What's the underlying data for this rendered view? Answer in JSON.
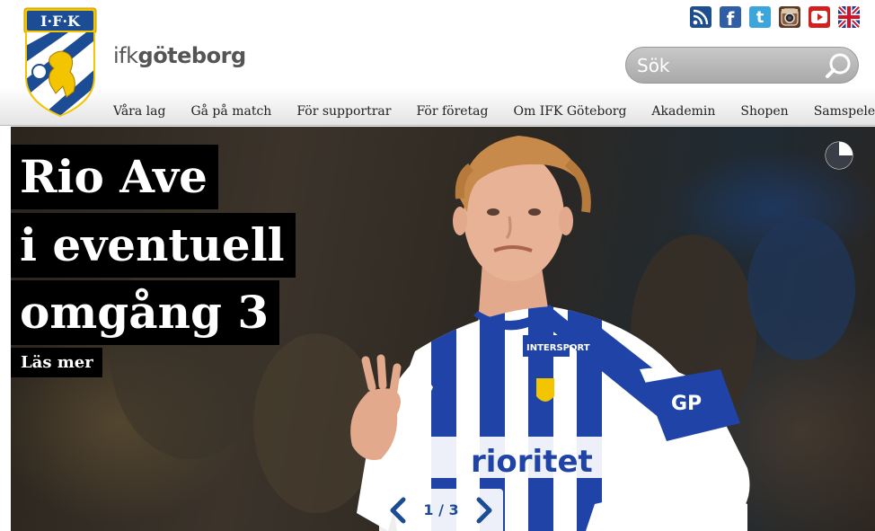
{
  "brand": {
    "logo_letters": "I·F·K",
    "wordmark_light": "ifk",
    "wordmark_bold": "göteborg"
  },
  "social": [
    {
      "name": "rss",
      "label": "RSS"
    },
    {
      "name": "facebook",
      "label": "f"
    },
    {
      "name": "twitter",
      "label": "t"
    },
    {
      "name": "instagram",
      "label": "Instagram"
    },
    {
      "name": "youtube",
      "label": "YouTube"
    },
    {
      "name": "english",
      "label": "English"
    }
  ],
  "search": {
    "placeholder": "Sök",
    "value": ""
  },
  "nav": {
    "items": [
      {
        "label": "Våra lag"
      },
      {
        "label": "Gå på match"
      },
      {
        "label": "För supportrar"
      },
      {
        "label": "För företag"
      },
      {
        "label": "Om IFK Göteborg"
      },
      {
        "label": "Akademin"
      },
      {
        "label": "Shopen"
      },
      {
        "label": "Samspelet"
      }
    ]
  },
  "hero": {
    "headline": [
      "Rio Ave",
      "i eventuell",
      "omgång 3"
    ],
    "read_more": "Läs mer",
    "slide_counter": "1 / 3",
    "jersey_sponsor": "rioritet",
    "sleeve_logo": "GP",
    "chest_logo": "INTERSPORT"
  },
  "colors": {
    "brand_blue": "#1c4d94",
    "headline_bg": "#000000",
    "header_bg": "#ffffff"
  }
}
